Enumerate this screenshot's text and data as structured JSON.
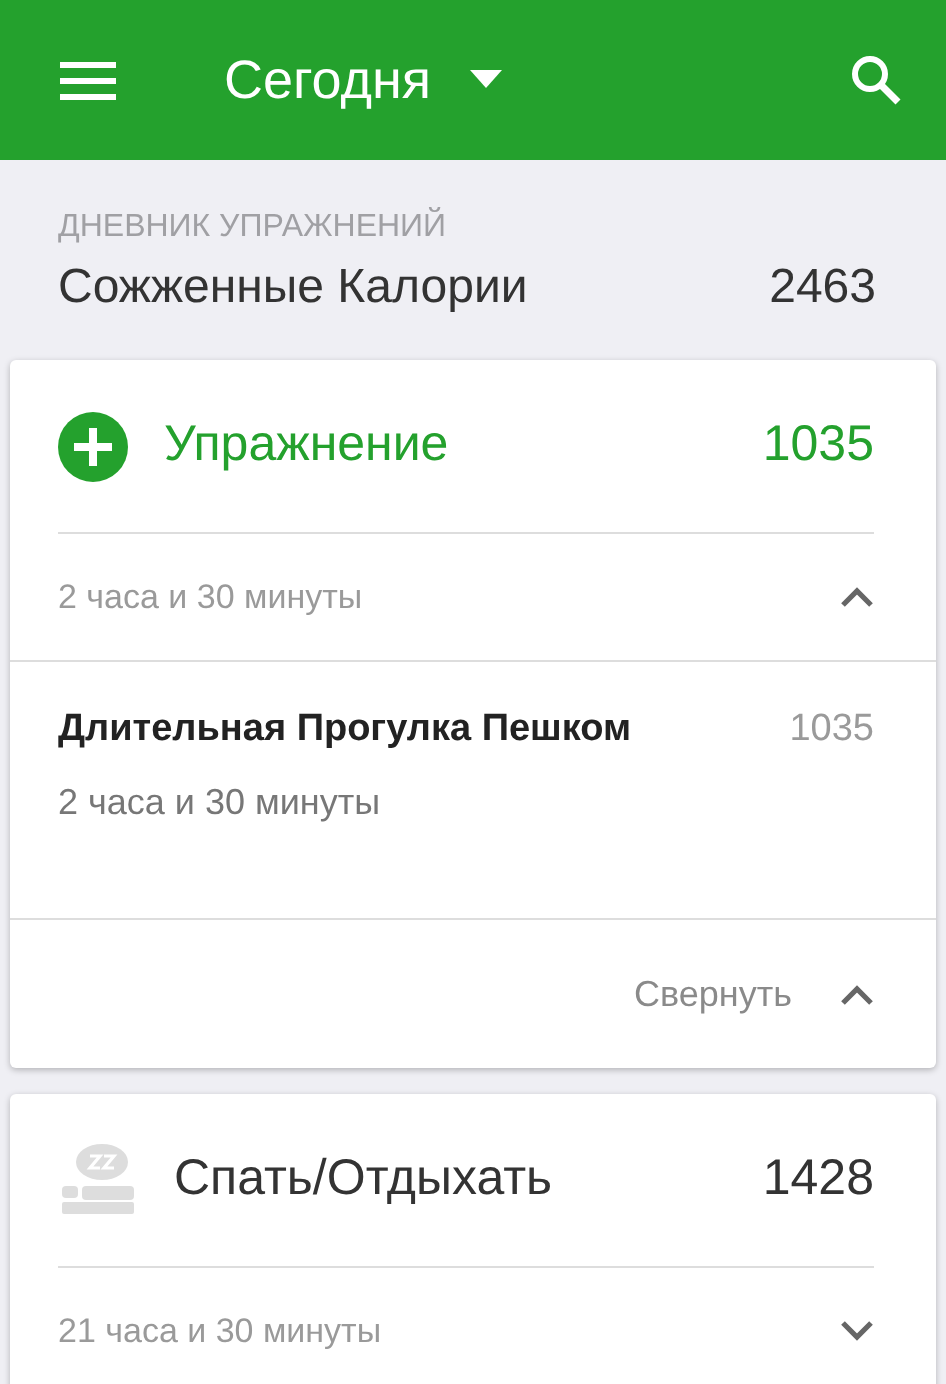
{
  "header": {
    "title": "Сегодня"
  },
  "section": {
    "label": "ДНЕВНИК УПРАЖНЕНИЙ",
    "title": "Сожженные Калории",
    "total": "2463"
  },
  "cards": [
    {
      "kind": "exercise",
      "title": "Упражнение",
      "calories": "1035",
      "duration": "2 часа и 30 минуты",
      "expanded": true,
      "entries": [
        {
          "name": "Длительная Прогулка Пешком",
          "calories": "1035",
          "duration": "2 часа и 30 минуты"
        }
      ],
      "collapse_label": "Свернуть"
    },
    {
      "kind": "sleep",
      "title": "Спать/Отдыхать",
      "calories": "1428",
      "duration": "21 часа и 30 минуты",
      "expanded": false
    }
  ]
}
